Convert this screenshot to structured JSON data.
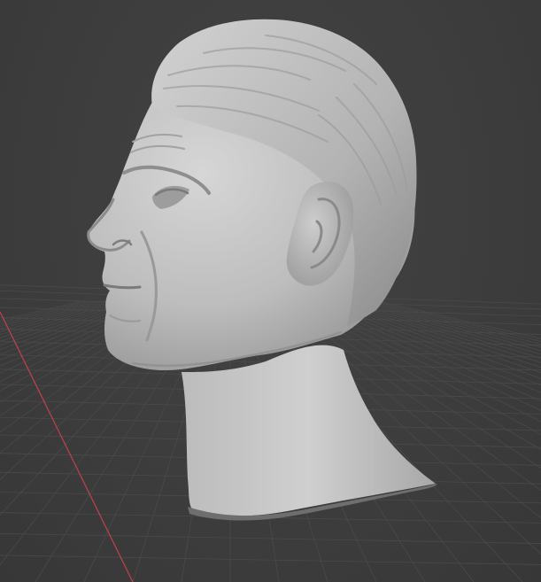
{
  "viewport": {
    "mode": "3d-viewport",
    "shading": "solid",
    "object": "sculpted-head",
    "grid_floor_visible": true,
    "colors": {
      "background": "#3d3d3d",
      "grid_line": "#4a4a4a",
      "x_axis": "#c0444c",
      "mesh": "#c8c8c8"
    }
  }
}
